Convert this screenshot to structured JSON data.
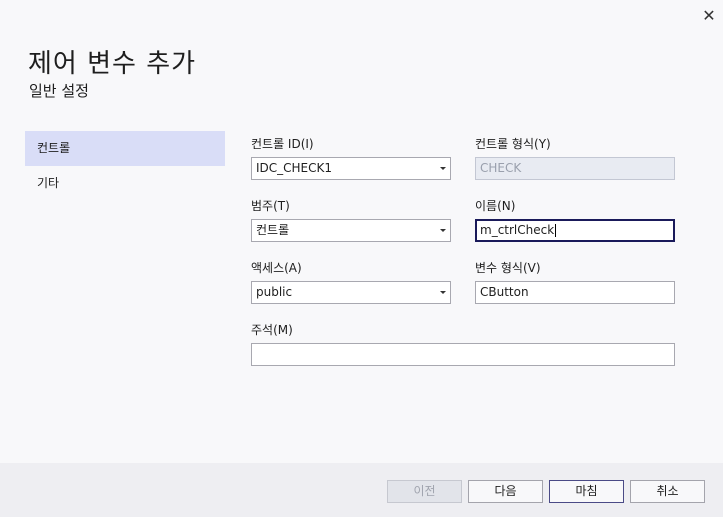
{
  "dialog": {
    "title": "제어 변수 추가",
    "subtitle": "일반 설정",
    "close_glyph": "✕"
  },
  "nav": {
    "items": [
      {
        "label": "컨트롤",
        "active": true
      },
      {
        "label": "기타",
        "active": false
      }
    ]
  },
  "form": {
    "control_id": {
      "label": "컨트롤 ID(I)",
      "value": "IDC_CHECK1"
    },
    "control_type": {
      "label": "컨트롤 형식(Y)",
      "value": "CHECK"
    },
    "category": {
      "label": "범주(T)",
      "value": "컨트롤"
    },
    "name": {
      "label": "이름(N)",
      "value": "m_ctrlCheck"
    },
    "access": {
      "label": "액세스(A)",
      "value": "public"
    },
    "var_type": {
      "label": "변수 형식(V)",
      "value": "CButton"
    },
    "comment": {
      "label": "주석(M)",
      "value": ""
    }
  },
  "footer": {
    "prev_label": "이전",
    "next_label": "다음",
    "finish_label": "마침",
    "cancel_label": "취소"
  }
}
